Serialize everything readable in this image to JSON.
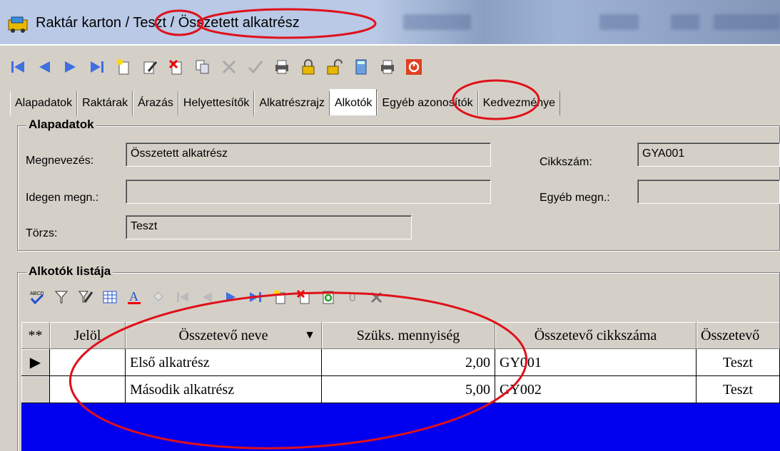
{
  "window": {
    "title_prefix": "Raktár karton /",
    "title_middle": "Teszt",
    "title_suffix": "Összetett alkatrész"
  },
  "toolbar": {
    "icons": [
      "first-record-icon",
      "prev-record-icon",
      "next-record-icon",
      "last-record-icon",
      "new-record-icon",
      "edit-record-icon",
      "delete-record-icon",
      "copy-record-icon",
      "cancel-icon",
      "confirm-icon",
      "print-icon",
      "lock-icon",
      "unlock-icon",
      "calculator-icon",
      "print-preview-icon",
      "close-icon"
    ]
  },
  "tabs": [
    {
      "label": "Alapadatok"
    },
    {
      "label": "Raktárak"
    },
    {
      "label": "Árazás"
    },
    {
      "label": "Helyettesítők"
    },
    {
      "label": "Alkatrészrajz"
    },
    {
      "label": "Alkotók",
      "active": true
    },
    {
      "label": "Egyéb azonosítók"
    },
    {
      "label": "Kedvezménye"
    }
  ],
  "basic": {
    "group_title": "Alapadatok",
    "name_label": "Megnevezés:",
    "name_value": "Összetett alkatrész",
    "foreign_label": "Idegen megn.:",
    "foreign_value": "",
    "base_label": "Törzs:",
    "base_value": "Teszt",
    "code_label": "Cikkszám:",
    "code_value": "GYA001",
    "other_label": "Egyéb megn.:",
    "other_value": ""
  },
  "components": {
    "group_title": "Alkotók listája",
    "toolbar_icons": [
      "spellcheck-icon",
      "filter-icon",
      "edit-filter-icon",
      "grid-icon",
      "font-color-icon",
      "fill-color-icon",
      "first-icon",
      "prev-icon",
      "next-icon",
      "last-icon",
      "new-row-icon",
      "delete-row-icon",
      "refresh-icon",
      "zero-icon",
      "tools-icon"
    ],
    "columns": [
      "**",
      "Jelöl",
      "Összetevő neve",
      "Szüks. mennyiség",
      "Összetevő cikkszáma",
      "Összetevő"
    ],
    "rows": [
      {
        "mark": "",
        "name": "Első alkatrész",
        "qty": "2,00",
        "code": "GY001",
        "base": "Teszt"
      },
      {
        "mark": "",
        "name": "Második alkatrész",
        "qty": "5,00",
        "code": "GY002",
        "base": "Teszt"
      }
    ]
  },
  "colors": {
    "annotation": "#e0101a",
    "grid_background": "#0000ee",
    "toolbar_blue": "#3f6fe0"
  }
}
